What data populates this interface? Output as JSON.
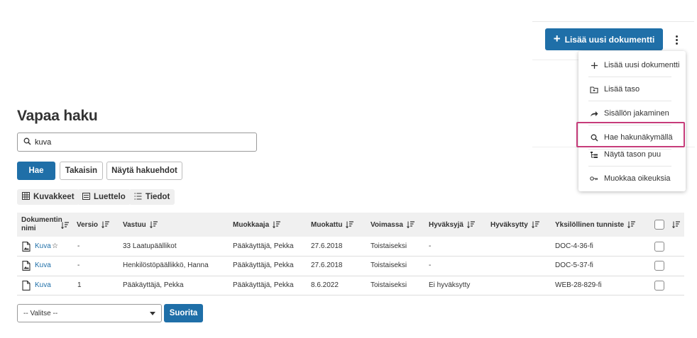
{
  "header": {
    "add_document_label": "Lisää uusi dokumentti"
  },
  "menu": {
    "items": [
      {
        "label": "Lisää uusi dokumentti",
        "icon": "plus-icon"
      },
      {
        "label": "Lisää taso",
        "icon": "folder-add-icon"
      },
      {
        "label": "Sisällön jakaminen",
        "icon": "share-arrow-icon"
      },
      {
        "label": "Hae hakunäkymällä",
        "icon": "search-icon"
      },
      {
        "label": "Näytä tason puu",
        "icon": "tree-icon"
      },
      {
        "label": "Muokkaa oikeuksia",
        "icon": "key-icon"
      }
    ],
    "highlighted_item": "Hae hakunäkymällä",
    "highlight_color": "#c63c7a"
  },
  "page": {
    "title": "Vapaa haku"
  },
  "search": {
    "value": "kuva",
    "placeholder": ""
  },
  "actions": {
    "search_label": "Hae",
    "back_label": "Takaisin",
    "show_criteria_label": "Näytä hakuehdot"
  },
  "views": {
    "thumbnails_label": "Kuvakkeet",
    "list_label": "Luettelo",
    "details_label": "Tiedot",
    "active": "Tiedot"
  },
  "table": {
    "columns": {
      "name": "Dokumentin nimi",
      "version": "Versio",
      "owner": "Vastuu",
      "modifier": "Muokkaaja",
      "modified": "Muokattu",
      "validity": "Voimassa",
      "approver": "Hyväksyjä",
      "approved": "Hyväksytty",
      "identifier": "Yksilöllinen tunniste"
    },
    "rows": [
      {
        "name": "Kuva",
        "star": "☆",
        "version": "-",
        "owner": "33 Laatupäällikot",
        "modifier": "Pääkäyttäjä, Pekka",
        "modified": "27.6.2018",
        "validity": "Toistaiseksi",
        "approver": "-",
        "approved": "",
        "identifier": "DOC-4-36-fi",
        "icon": "image-document-icon"
      },
      {
        "name": "Kuva",
        "star": "",
        "version": "-",
        "owner": "Henkilöstöpäällikkö, Hanna",
        "modifier": "Pääkäyttäjä, Pekka",
        "modified": "27.6.2018",
        "validity": "Toistaiseksi",
        "approver": "-",
        "approved": "",
        "identifier": "DOC-5-37-fi",
        "icon": "image-document-icon"
      },
      {
        "name": "Kuva",
        "star": "",
        "version": "1",
        "owner": "Pääkäyttäjä, Pekka",
        "modifier": "Pääkäyttäjä, Pekka",
        "modified": "8.6.2022",
        "validity": "Toistaiseksi",
        "approver": "Ei hyväksytty",
        "approved": "",
        "identifier": "WEB-28-829-fi",
        "icon": "document-icon"
      }
    ]
  },
  "bulk": {
    "select_value": "-- Valitse --",
    "run_label": "Suorita"
  },
  "colors": {
    "primary": "#1f6fa8",
    "link": "#1f6fa8",
    "highlight": "#c63c7a"
  }
}
